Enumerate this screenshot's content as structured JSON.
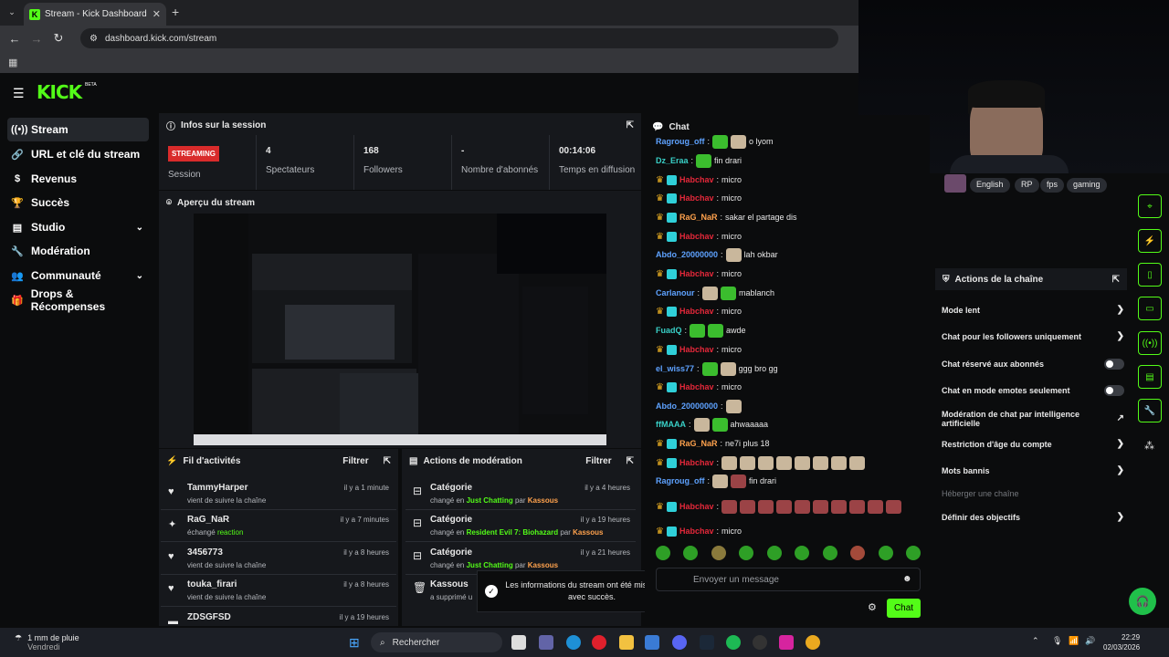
{
  "browser": {
    "tab_title": "Stream - Kick Dashboard",
    "url": "dashboard.kick.com/stream"
  },
  "brand": {
    "logo": "KICK",
    "beta": "BETA",
    "accent": "#53fc18"
  },
  "sidebar": {
    "items": [
      {
        "label": "Stream",
        "icon": "stream-icon"
      },
      {
        "label": "URL et clé du stream",
        "icon": "link-icon"
      },
      {
        "label": "Revenus",
        "icon": "dollar-icon"
      },
      {
        "label": "Succès",
        "icon": "trophy-icon"
      },
      {
        "label": "Studio",
        "icon": "studio-icon"
      },
      {
        "label": "Modération",
        "icon": "wrench-icon"
      },
      {
        "label": "Communauté",
        "icon": "people-icon"
      },
      {
        "label": "Drops & Récompenses",
        "icon": "gift-icon"
      }
    ]
  },
  "session": {
    "title": "Infos sur la session",
    "status": "STREAMING",
    "status_label": "Session",
    "stats": [
      {
        "value": "4",
        "label": "Spectateurs"
      },
      {
        "value": "168",
        "label": "Followers"
      },
      {
        "value": "-",
        "label": "Nombre d'abonnés"
      },
      {
        "value": "00:14:06",
        "label": "Temps en diffusion"
      }
    ]
  },
  "preview": {
    "title": "Aperçu du stream"
  },
  "activity": {
    "title": "Fil d'activités",
    "filter": "Filtrer",
    "items": [
      {
        "name": "TammyHarper",
        "time": "il y a 1 minute",
        "sub": "vient de suivre la chaîne"
      },
      {
        "name": "RaG_NaR",
        "time": "il y a 7 minutes",
        "sub": "échangé",
        "sub2": "reaction"
      },
      {
        "name": "3456773",
        "time": "il y a 8 heures",
        "sub": "vient de suivre la chaîne"
      },
      {
        "name": "touka_firari",
        "time": "il y a 8 heures",
        "sub": "vient de suivre la chaîne"
      },
      {
        "name": "ZDSGFSD",
        "time": "il y a 19 heures",
        "sub": ""
      }
    ]
  },
  "moderation": {
    "title": "Actions de modération",
    "filter": "Filtrer",
    "items": [
      {
        "name": "Catégorie",
        "time": "il y a 4 heures",
        "pre": "changé en",
        "cat": "Just Chatting",
        "by": "par",
        "user": "Kassous"
      },
      {
        "name": "Catégorie",
        "time": "il y a 19 heures",
        "pre": "changé en",
        "cat": "Resident Evil 7: Biohazard",
        "by": "par",
        "user": "Kassous"
      },
      {
        "name": "Catégorie",
        "time": "il y a 21 heures",
        "pre": "changé en",
        "cat": "Just Chatting",
        "by": "par",
        "user": "Kassous"
      },
      {
        "name": "Kassous",
        "time": "",
        "pre": "a supprimé u",
        "cat": "",
        "by": "",
        "user": ""
      }
    ]
  },
  "toast": {
    "message": "Les informations du stream ont été mises à jour avec succès."
  },
  "chat": {
    "title": "Chat",
    "placeholder": "Envoyer un message",
    "send": "Chat",
    "messages": [
      {
        "user": "Ragroug_off",
        "text": "o lyom"
      },
      {
        "user": "Dz_Eraa",
        "text": "fin drari"
      },
      {
        "user": "Habchav",
        "text": "micro"
      },
      {
        "user": "Habchav",
        "text": "micro"
      },
      {
        "user": "RaG_NaR",
        "text": "sakar el partage dis"
      },
      {
        "user": "Habchav",
        "text": "micro"
      },
      {
        "user": "Abdo_20000000",
        "text": "lah okbar"
      },
      {
        "user": "Habchav",
        "text": "micro"
      },
      {
        "user": "Carlanour",
        "text": "mablanch"
      },
      {
        "user": "Habchav",
        "text": "micro"
      },
      {
        "user": "FuadQ",
        "text": "awde"
      },
      {
        "user": "Habchav",
        "text": "micro"
      },
      {
        "user": "el_wiss77",
        "text": "ggg bro gg"
      },
      {
        "user": "Habchav",
        "text": "micro"
      },
      {
        "user": "Abdo_20000000",
        "text": ""
      },
      {
        "user": "ffMAAA",
        "text": "ahwaaaaa"
      },
      {
        "user": "RaG_NaR",
        "text": "ne7i plus 18"
      },
      {
        "user": "Habchav",
        "text": ""
      },
      {
        "user": "Ragroug_off",
        "text": "fin drari"
      },
      {
        "user": "Habchav",
        "text": ""
      },
      {
        "user": "Habchav",
        "text": "micro"
      }
    ]
  },
  "stream_info": {
    "tags": [
      "English",
      "RP",
      "fps",
      "gaming"
    ]
  },
  "channel_actions": {
    "title": "Actions de la chaîne",
    "items": [
      "Mode lent",
      "Chat pour les followers uniquement",
      "Chat réservé aux abonnés",
      "Chat en mode emotes seulement",
      "Modération de chat par intelligence artificielle",
      "Restriction d'âge du compte",
      "Mots bannis",
      "Héberger une chaîne",
      "Définir des objectifs"
    ]
  },
  "taskbar": {
    "weather": "1 mm de pluie",
    "day": "Vendredi",
    "search": "Rechercher",
    "time": "22:29",
    "date": "02/03/2026"
  }
}
